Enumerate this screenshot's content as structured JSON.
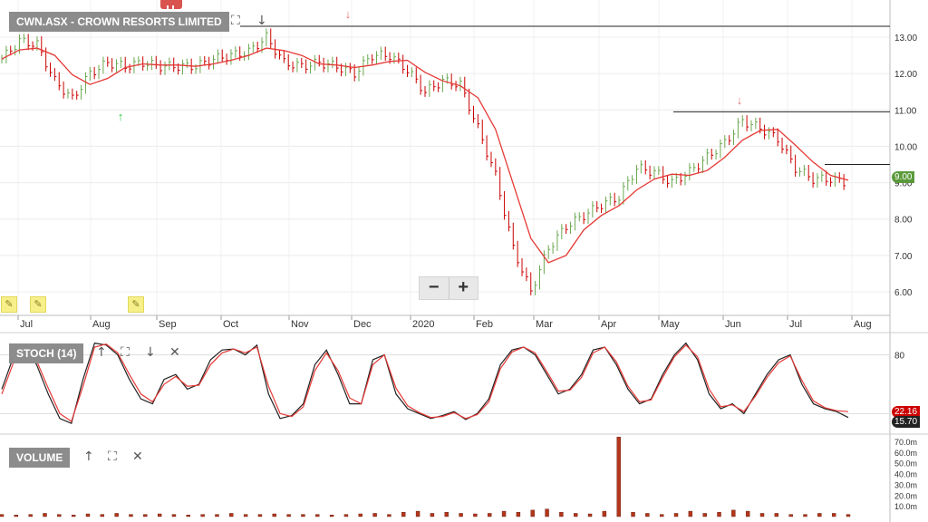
{
  "symbol_title": "CWN.ASX - CROWN RESORTS LIMITED",
  "price_ticks": [
    "13.00",
    "12.00",
    "11.00",
    "10.00",
    "9.00",
    "8.00",
    "7.00",
    "6.00"
  ],
  "price_tag": "9.00",
  "month_labels": [
    "Jul",
    "Aug",
    "Sep",
    "Oct",
    "Nov",
    "Dec",
    "2020",
    "Feb",
    "Mar",
    "Apr",
    "May",
    "Jun",
    "Jul",
    "Aug"
  ],
  "zoom": {
    "minus": "−",
    "plus": "+"
  },
  "stoch": {
    "label": "STOCH (14)",
    "tick": "80",
    "tag_red": "22.16",
    "tag_black": "15.70"
  },
  "volume": {
    "label": "VOLUME",
    "ticks": [
      "70.0m",
      "60.0m",
      "50.0m",
      "40.0m",
      "30.0m",
      "20.0m",
      "10.0m"
    ]
  },
  "icons": {
    "expand": "⛶",
    "down": "↓",
    "up": "↑",
    "close": "✕"
  },
  "colors": {
    "up": "#6aa84f",
    "down": "#cc0000",
    "ma": "#e53935",
    "label": "#8c8c8c",
    "volume": "#b5361c"
  },
  "chart_data": [
    {
      "type": "line",
      "title": "CWN.ASX - CROWN RESORTS LIMITED",
      "x": [
        "2019-07",
        "2019-08",
        "2019-09",
        "2019-10",
        "2019-11",
        "2019-12",
        "2020-01",
        "2020-02",
        "2020-03",
        "2020-04",
        "2020-05",
        "2020-06",
        "2020-07",
        "2020-08"
      ],
      "series": [
        {
          "values": [
            12.4,
            12.9,
            12.8,
            11.8,
            11.3,
            12.0,
            12.3,
            12.2,
            12.3,
            12.2,
            12.2,
            12.2,
            12.4,
            12.5,
            12.6,
            13.0,
            12.3,
            12.2,
            12.3,
            12.2,
            12.0,
            12.5,
            12.5,
            12.1,
            11.5,
            11.8,
            11.7,
            10.5,
            9.2,
            7.2,
            6.0,
            7.2,
            7.8,
            8.1,
            8.4,
            8.6,
            9.4,
            9.3,
            9.0,
            9.3,
            9.7,
            10.1,
            10.7,
            10.5,
            10.2,
            9.4,
            9.1,
            9.1,
            9.0
          ]
        }
      ],
      "ylim": [
        5.6,
        13.4
      ],
      "annotations": [
        "peak arrow Dec",
        "trough arrow Aug",
        "peak arrow Jun"
      ]
    },
    {
      "type": "line",
      "title": "STOCH (14)",
      "ylim": [
        0,
        100
      ],
      "series": [
        {
          "values": [
            45,
            78,
            86,
            70,
            40,
            15,
            10,
            55,
            92,
            90,
            80,
            55,
            35,
            30,
            55,
            60,
            45,
            50,
            75,
            85,
            86,
            80,
            90,
            40,
            15,
            18,
            30,
            70,
            85,
            60,
            30,
            30,
            75,
            80,
            40,
            25,
            20,
            15,
            18,
            22,
            14,
            20,
            35,
            70,
            85,
            88,
            80,
            60,
            40,
            45,
            60,
            85,
            88,
            70,
            45,
            30,
            35,
            60,
            80,
            92,
            75,
            40,
            25,
            30,
            20,
            40,
            60,
            75,
            80,
            50,
            30,
            25,
            22,
            16
          ]
        },
        {
          "values": [
            40,
            72,
            84,
            74,
            46,
            20,
            12,
            48,
            88,
            91,
            82,
            60,
            40,
            32,
            50,
            58,
            48,
            49,
            70,
            82,
            86,
            82,
            88,
            48,
            20,
            17,
            27,
            64,
            82,
            64,
            36,
            30,
            70,
            80,
            46,
            28,
            21,
            16,
            17,
            21,
            15,
            19,
            32,
            66,
            83,
            88,
            82,
            63,
            43,
            44,
            57,
            82,
            88,
            73,
            48,
            32,
            34,
            57,
            78,
            90,
            78,
            45,
            27,
            29,
            22,
            38,
            57,
            72,
            79,
            54,
            33,
            26,
            23,
            22
          ]
        }
      ]
    },
    {
      "type": "bar",
      "title": "VOLUME",
      "ylim": [
        0,
        75
      ],
      "values": [
        2,
        1.5,
        2,
        3,
        2,
        1.5,
        2.5,
        2,
        3,
        2,
        2,
        2.5,
        2,
        1.5,
        2,
        2,
        3,
        2,
        2,
        2.5,
        2,
        2,
        2,
        1.5,
        2,
        2.5,
        3,
        2,
        4,
        5,
        3,
        4,
        3,
        2.5,
        3,
        5,
        4,
        6,
        7,
        4,
        3,
        2.5,
        5,
        74,
        4,
        3,
        2,
        3,
        5,
        3,
        4,
        6,
        5,
        3,
        3,
        2,
        2,
        3,
        3,
        2
      ]
    }
  ]
}
